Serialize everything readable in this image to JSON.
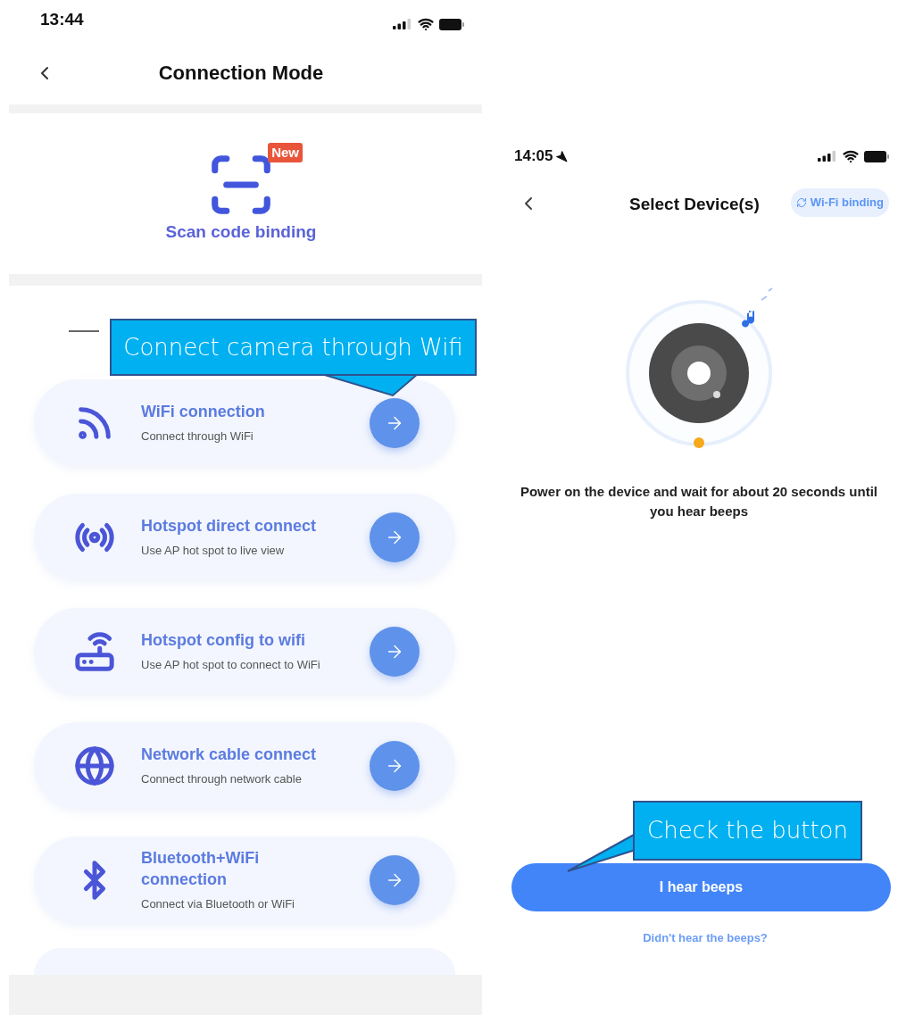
{
  "left_screen": {
    "status_bar": {
      "time": "13:44"
    },
    "title": "Connection Mode",
    "scan": {
      "label": "Scan code binding",
      "badge": "New"
    },
    "options": [
      {
        "kind": "wifi",
        "title": "WiFi connection",
        "subtitle": "Connect through WiFi"
      },
      {
        "kind": "hotspot",
        "title": "Hotspot direct connect",
        "subtitle": "Use AP hot spot to live view"
      },
      {
        "kind": "router",
        "title": "Hotspot config to wifi",
        "subtitle": "Use AP hot spot to connect to WiFi"
      },
      {
        "kind": "globe",
        "title": "Network cable connect",
        "subtitle": "Connect through network cable"
      },
      {
        "kind": "bluetooth",
        "title": "Bluetooth+WiFi connection",
        "subtitle": "Connect via Bluetooth or WiFi"
      }
    ]
  },
  "right_screen": {
    "status_bar": {
      "time": "14:05"
    },
    "title": "Select Device(s)",
    "mode_badge": "Wi-Fi binding",
    "instruction": "Power on the device and wait for about 20 seconds until you hear beeps",
    "primary_button": "I hear beeps",
    "link": "Didn't hear the beeps?"
  },
  "callouts": [
    "Connect camera through Wifi",
    "Check the button"
  ]
}
